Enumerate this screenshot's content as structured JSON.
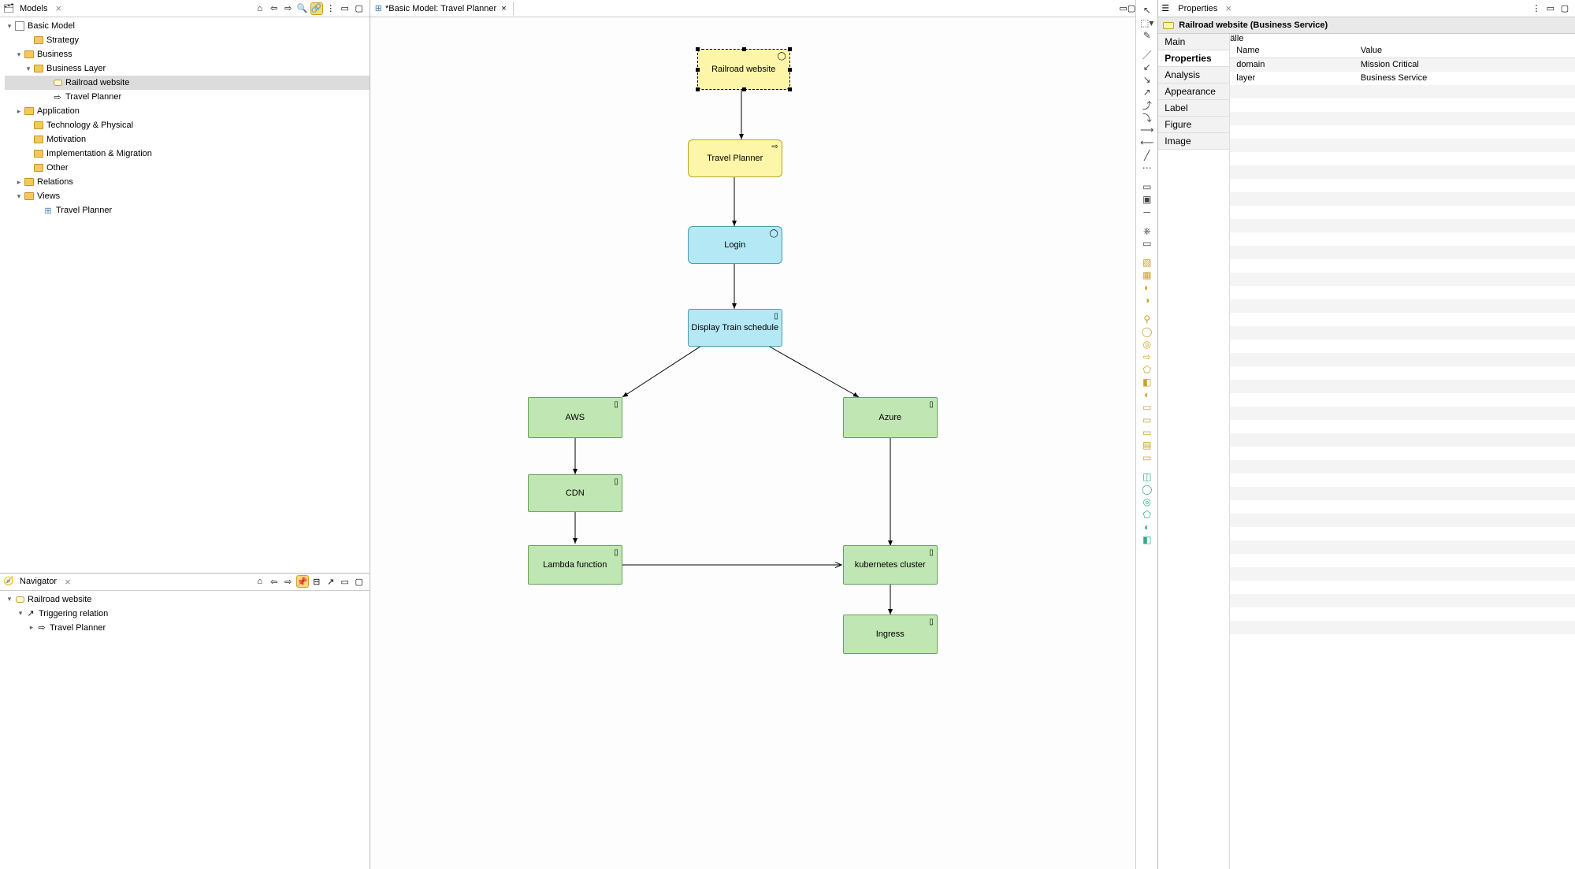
{
  "left_panels": {
    "models": {
      "title": "Models",
      "tools": [
        "home-icon",
        "back-icon",
        "forward-icon",
        "search-icon",
        "link-icon",
        "menu-icon",
        "min-icon",
        "max-icon"
      ]
    },
    "navigator": {
      "title": "Navigator"
    }
  },
  "model_tree": {
    "root": "Basic Model",
    "nodes": {
      "strategy": "Strategy",
      "business": "Business",
      "business_layer": "Business Layer",
      "railroad_website": "Railroad website",
      "travel_planner": "Travel Planner",
      "application": "Application",
      "technology": "Technology & Physical",
      "motivation": "Motivation",
      "implementation": "Implementation & Migration",
      "other": "Other",
      "relations": "Relations",
      "views": "Views",
      "view_travel_planner": "Travel Planner"
    }
  },
  "navigator_tree": {
    "root": "Railroad website",
    "triggering": "Triggering relation",
    "travel_planner": "Travel Planner"
  },
  "editor_tab": {
    "label": "*Basic Model: Travel Planner"
  },
  "diagram": {
    "nodes": {
      "railroad_website": "Railroad website",
      "travel_planner": "Travel Planner",
      "login": "Login",
      "display_train": "Display Train schedule",
      "aws": "AWS",
      "azure": "Azure",
      "cdn": "CDN",
      "lambda": "Lambda function",
      "k8s": "kubernetes cluster",
      "ingress": "Ingress"
    }
  },
  "properties": {
    "title": "Properties",
    "heading": "Railroad website (Business Service)",
    "tabs": [
      "Main",
      "Properties",
      "Analysis",
      "Appearance",
      "Label",
      "Figure",
      "Image"
    ],
    "current_tab": "Properties",
    "columns": {
      "name": "Name",
      "value": "Value"
    },
    "rows": [
      {
        "name": "domain",
        "value": "Mission Critical"
      },
      {
        "name": "layer",
        "value": "Business Service"
      }
    ]
  }
}
